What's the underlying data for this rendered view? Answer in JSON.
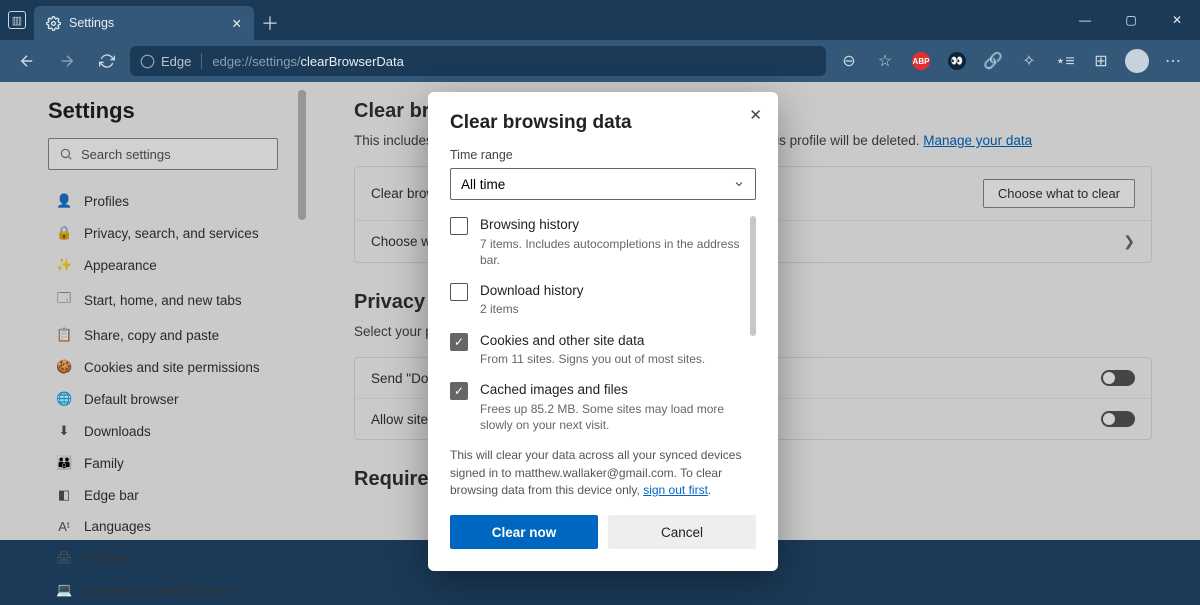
{
  "titlebar": {
    "tab_title": "Settings"
  },
  "toolbar": {
    "edge_label": "Edge",
    "url_dim": "edge://settings/",
    "url_bright": "clearBrowserData"
  },
  "sidebar": {
    "heading": "Settings",
    "search_placeholder": "Search settings",
    "items": [
      {
        "icon": "👤",
        "label": "Profiles"
      },
      {
        "icon": "🔒",
        "label": "Privacy, search, and services"
      },
      {
        "icon": "✨",
        "label": "Appearance"
      },
      {
        "icon": "🗔",
        "label": "Start, home, and new tabs"
      },
      {
        "icon": "📋",
        "label": "Share, copy and paste"
      },
      {
        "icon": "🍪",
        "label": "Cookies and site permissions"
      },
      {
        "icon": "🌐",
        "label": "Default browser"
      },
      {
        "icon": "⬇",
        "label": "Downloads"
      },
      {
        "icon": "👪",
        "label": "Family"
      },
      {
        "icon": "◧",
        "label": "Edge bar"
      },
      {
        "icon": "Aᵗ",
        "label": "Languages"
      },
      {
        "icon": "🖨",
        "label": "Printers"
      },
      {
        "icon": "💻",
        "label": "System and performance"
      }
    ]
  },
  "main": {
    "heading": "Clear browsing data",
    "sub_prefix": "This includes history, passwords, cookies, and more. Only data from this profile will be deleted. ",
    "sub_link": "Manage your data",
    "row1_label": "Clear browsing data now",
    "row1_button": "Choose what to clear",
    "row2_label": "Choose what to clear every time you close the browser",
    "privacy_heading": "Privacy",
    "privacy_sub": "Select your privacy settings for Microsoft Edge.",
    "dnt_label": "Send \"Do Not Track\" requests",
    "allow_label": "Allow sites to check if you have payment methods saved",
    "required_heading": "Required diagnostic data"
  },
  "modal": {
    "title": "Clear browsing data",
    "time_range_label": "Time range",
    "time_range_value": "All time",
    "items": [
      {
        "checked": false,
        "label": "Browsing history",
        "desc": "7 items. Includes autocompletions in the address bar."
      },
      {
        "checked": false,
        "label": "Download history",
        "desc": "2 items"
      },
      {
        "checked": true,
        "label": "Cookies and other site data",
        "desc": "From 11 sites. Signs you out of most sites."
      },
      {
        "checked": true,
        "label": "Cached images and files",
        "desc": "Frees up 85.2 MB. Some sites may load more slowly on your next visit."
      }
    ],
    "sync_note_1": "This will clear your data across all your synced devices signed in to matthew.wallaker@gmail.com. To clear browsing data from this device only, ",
    "sync_note_link": "sign out first",
    "sync_note_2": ".",
    "clear_btn": "Clear now",
    "cancel_btn": "Cancel"
  }
}
